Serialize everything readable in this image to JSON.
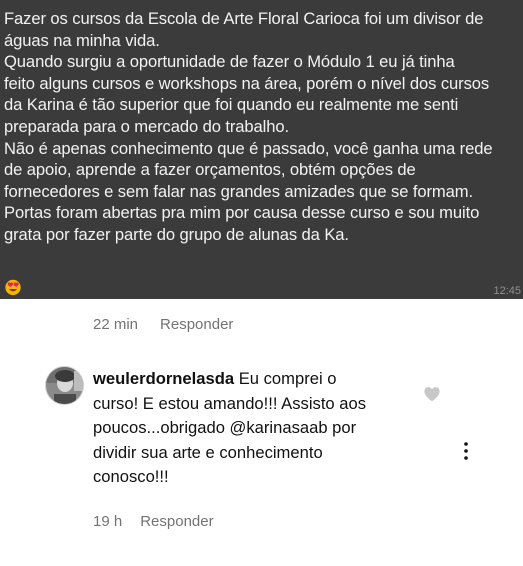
{
  "chat": {
    "lines": [
      "Fazer os cursos da Escola de Arte Floral Carioca foi um divisor de",
      "águas na minha vida.",
      "Quando surgiu a oportunidade de fazer o Módulo 1 eu já tinha",
      "feito alguns cursos e workshops na área, porém o nível dos cursos",
      "da Karina é tão superior que foi quando eu realmente me senti",
      "preparada para o mercado do trabalho.",
      "Não é apenas conhecimento que é passado, você ganha uma rede",
      "de apoio, aprende a fazer orçamentos, obtém opções de",
      "fornecedores e sem falar nas grandes amizades que se formam.",
      "Portas foram abertas pra mim por causa desse curso e sou muito",
      "grata por fazer parte do grupo de alunas da Ka."
    ],
    "emoji_icon": "smiling-face-with-heart-eyes-icon",
    "time": "12:45"
  },
  "first_meta": {
    "age": "22 min",
    "reply_label": "Responder"
  },
  "comment": {
    "username": "weulerdornelasda",
    "text_first": " Eu comprei o",
    "lines": [
      "curso! E estou amando!!! Assisto aos",
      "poucos...obrigado @karinasaab  por",
      "dividir sua arte e conhecimento",
      "conosco!!!"
    ],
    "age": "19 h",
    "reply_label": "Responder",
    "like_icon": "heart-icon",
    "more_icon": "more-options-icon"
  },
  "colors": {
    "chat_background": "#3b3b3b",
    "chat_text": "#f2f2f2",
    "meta_text": "#737373",
    "comment_text": "#111111",
    "heart": "#c7c7c7"
  }
}
